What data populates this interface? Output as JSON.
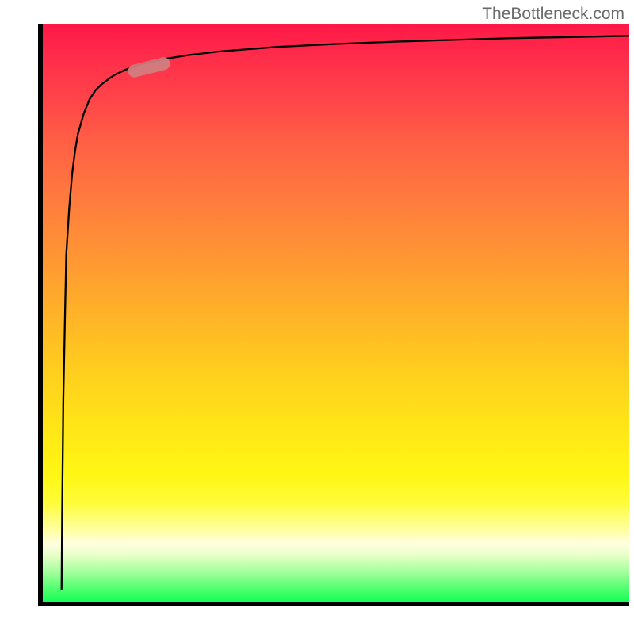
{
  "watermark": "TheBottleneck.com",
  "chart_data": {
    "type": "line",
    "title": "",
    "xlabel": "",
    "ylabel": "",
    "xlim": [
      0,
      100
    ],
    "ylim": [
      0,
      100
    ],
    "series": [
      {
        "name": "curve",
        "x": [
          3.2,
          3.3,
          3.5,
          3.8,
          4.0,
          4.5,
          5.0,
          5.5,
          6.0,
          7.0,
          8.0,
          9.0,
          10.0,
          12.0,
          14.0,
          16.0,
          18.0,
          20.0,
          25.0,
          30.0,
          35.0,
          40.0,
          50.0,
          60.0,
          70.0,
          80.0,
          90.0,
          100.0
        ],
        "y": [
          2.0,
          15.0,
          35.0,
          50.0,
          60.0,
          68.0,
          74.0,
          78.0,
          81.0,
          84.5,
          87.0,
          88.5,
          89.5,
          91.0,
          92.0,
          92.8,
          93.3,
          93.8,
          94.6,
          95.2,
          95.6,
          96.0,
          96.5,
          96.9,
          97.2,
          97.5,
          97.7,
          97.9
        ]
      }
    ],
    "marker": {
      "x_range": [
        15,
        21
      ],
      "y_range": [
        92,
        94
      ]
    },
    "gradient_colors": {
      "top": "#ff1846",
      "upper_mid": "#ff7a3e",
      "mid": "#ffce1e",
      "lower_mid": "#fff713",
      "bottom": "#17ff58"
    }
  }
}
